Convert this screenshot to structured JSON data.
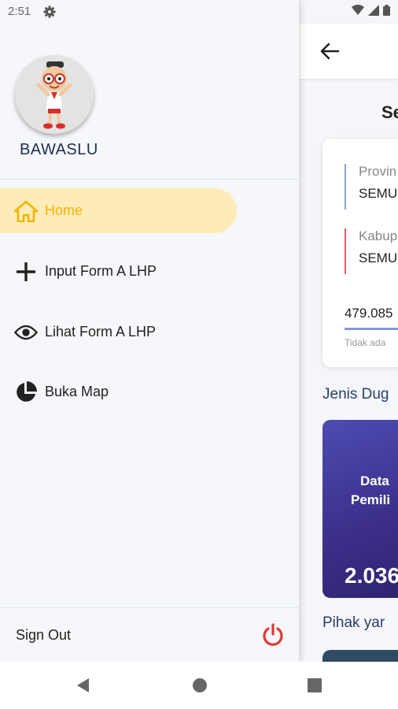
{
  "status_bar": {
    "time": "2:51",
    "icons": [
      "gear-icon",
      "wifi-icon",
      "signal-icon",
      "battery-icon"
    ]
  },
  "background_screen": {
    "title_partial": "Se",
    "province_label": "Provin",
    "province_value": "SEMU",
    "regency_label": "Kabup",
    "regency_value": "SEMU",
    "total_partial": "479.085",
    "note_partial": "Tidak ada",
    "section_violation_type": "Jenis Dug",
    "data_card_line1": "Data",
    "data_card_line2": "Pemili",
    "data_card_number": "2.036",
    "section_party": "Pihak yar"
  },
  "drawer": {
    "brand": "BAWASLU",
    "menu": [
      {
        "label": "Home",
        "icon": "home-icon",
        "active": true
      },
      {
        "label": "Input Form A LHP",
        "icon": "plus-icon",
        "active": false
      },
      {
        "label": "Lihat Form A LHP",
        "icon": "eye-icon",
        "active": false
      },
      {
        "label": "Buka Map",
        "icon": "pie-chart-icon",
        "active": false
      }
    ],
    "sign_out": "Sign Out"
  },
  "colors": {
    "accent": "#f6b400",
    "active_bg": "#fdecb8",
    "power": "#e53935",
    "brand_text": "#1f2f4f"
  }
}
